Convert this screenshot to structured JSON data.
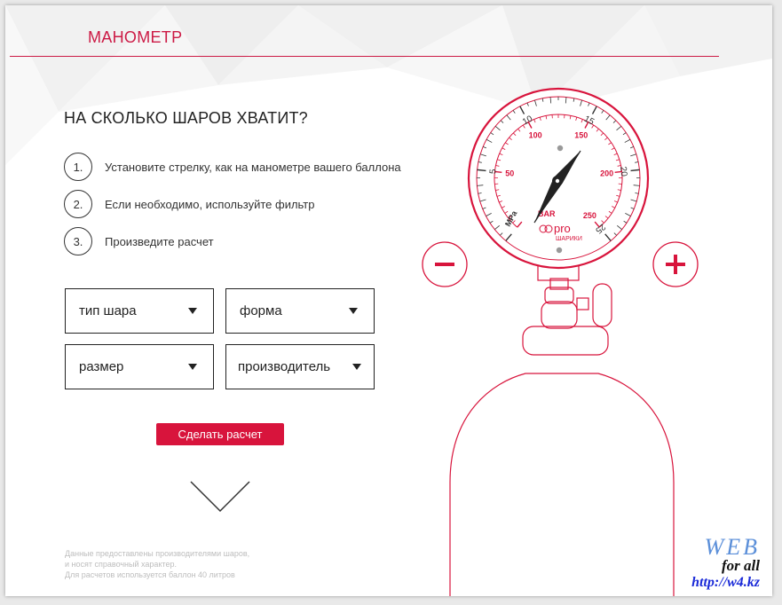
{
  "header": {
    "title": "МАНОМЕТР"
  },
  "heading": "НА СКОЛЬКО ШАРОВ ХВАТИТ?",
  "steps": [
    {
      "num": "1.",
      "text": "Установите стрелку, как на манометре вашего баллона"
    },
    {
      "num": "2.",
      "text": "Если необходимо, используйте фильтр"
    },
    {
      "num": "3.",
      "text": "Произведите расчет"
    }
  ],
  "filters": {
    "type": "тип шара",
    "shape": "форма",
    "size": "размер",
    "maker": "производитель"
  },
  "calc_button": "Сделать расчет",
  "footer": [
    "Данные предоставлены производителями шаров,",
    "и носят справочный характер.",
    "Для расчетов используется баллон 40 литров"
  ],
  "gauge": {
    "mpa_ticks": [
      "5",
      "10",
      "15",
      "20",
      "25"
    ],
    "bar_ticks": [
      "50",
      "100",
      "150",
      "200",
      "250"
    ],
    "bar_unit": "BAR",
    "mpa_unit": "MPa",
    "brand_pro": "pro",
    "brand_name": "ШАРИКИ",
    "minus_label": "−",
    "plus_label": "+"
  },
  "watermark": {
    "line1": "WEB",
    "line2": "for all",
    "line3": "http://w4.kz"
  },
  "colors": {
    "accent": "#d8143c",
    "title": "#cc1a45"
  }
}
